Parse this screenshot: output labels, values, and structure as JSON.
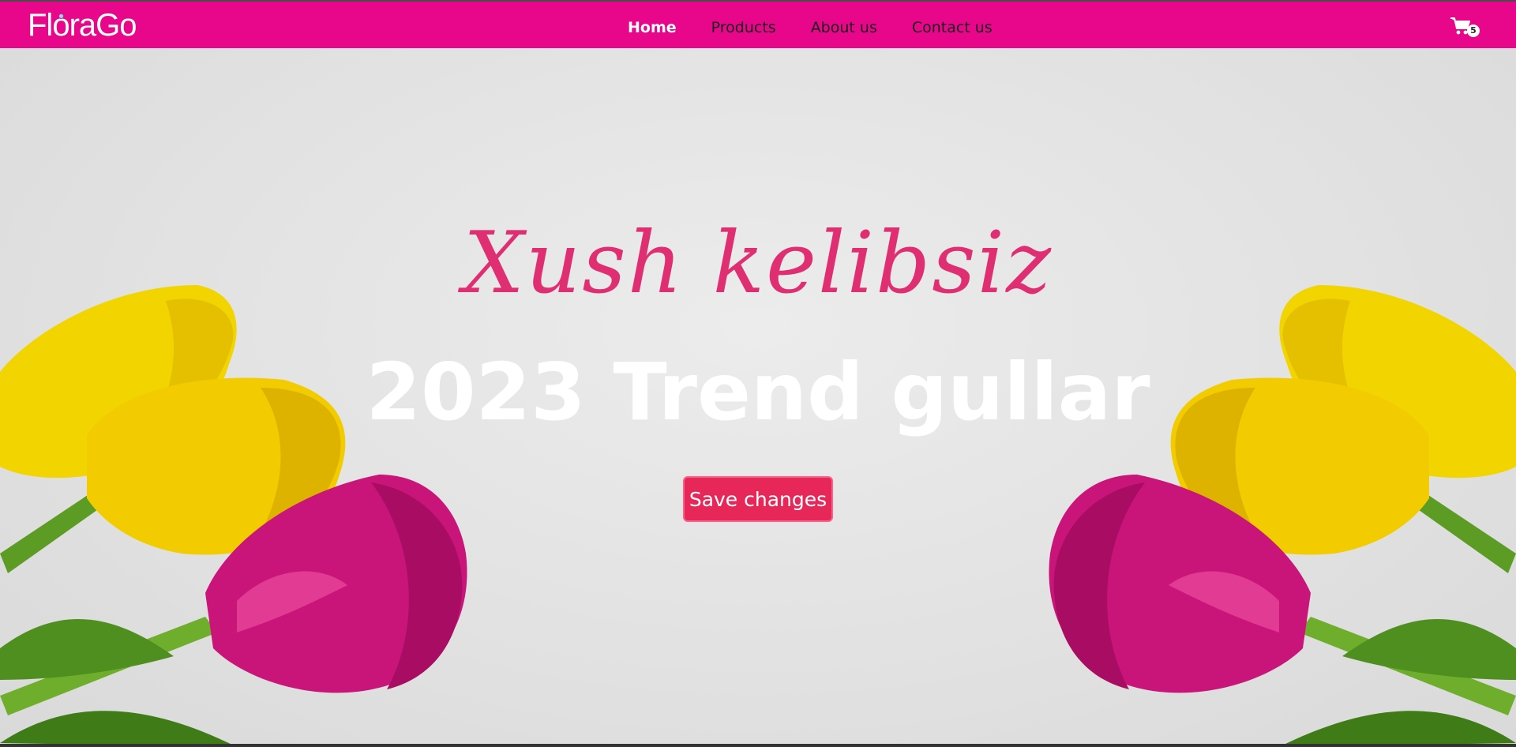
{
  "brand": {
    "logo_pre": "Fl",
    "logo_o": "o",
    "logo_post": "raGo",
    "color": "#e8078a"
  },
  "nav": {
    "items": [
      {
        "label": "Home",
        "active": true
      },
      {
        "label": "Products",
        "active": false
      },
      {
        "label": "About us",
        "active": false
      },
      {
        "label": "Contact us",
        "active": false
      }
    ]
  },
  "cart": {
    "icon": "cart-icon",
    "count": "5"
  },
  "hero": {
    "welcome": "Xush kelibsiz",
    "headline": "2023 Trend gullar",
    "button_label": "Save changes",
    "welcome_color": "#df2f72",
    "button_color": "#e62757"
  }
}
